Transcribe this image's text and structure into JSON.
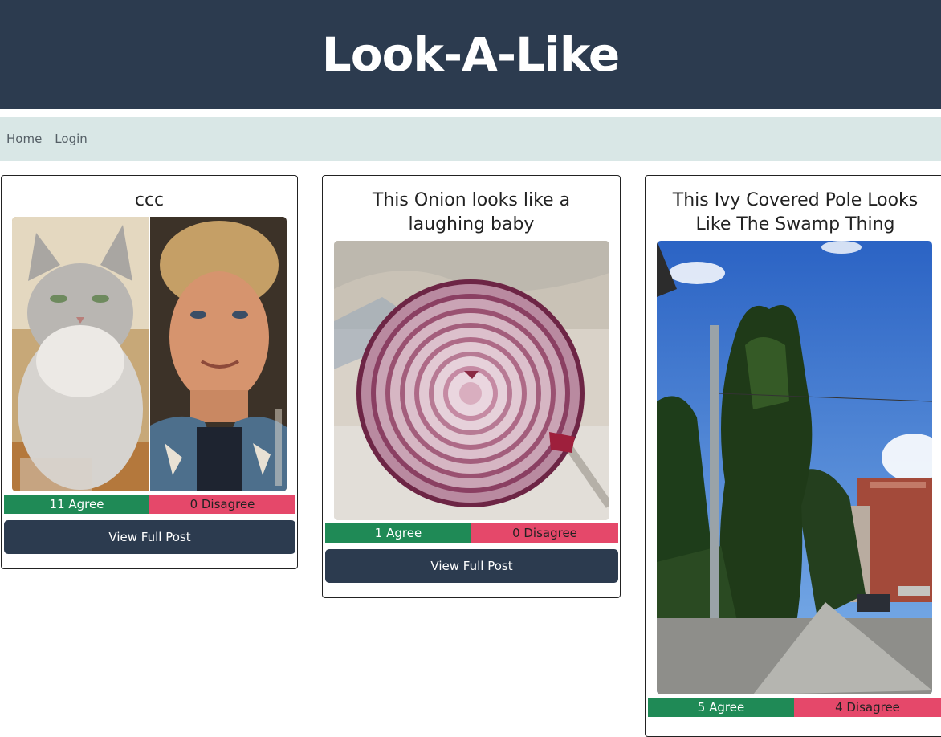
{
  "header": {
    "title": "Look-A-Like"
  },
  "nav": {
    "home": "Home",
    "login": "Login"
  },
  "colors": {
    "header_bg": "#2c3b4f",
    "nav_bg": "#d9e7e6",
    "agree": "#1f8a56",
    "disagree": "#e5486a",
    "button": "#2c3b4f"
  },
  "posts": [
    {
      "title": "ccc",
      "agree": "11 Agree",
      "disagree": "0 Disagree",
      "button": "View Full Post"
    },
    {
      "title": "This Onion looks like a laughing baby",
      "agree": "1 Agree",
      "disagree": "0 Disagree",
      "button": "View Full Post"
    },
    {
      "title": "This Ivy Covered Pole Looks Like The Swamp Thing",
      "agree": "5 Agree",
      "disagree": "4 Disagree"
    }
  ]
}
